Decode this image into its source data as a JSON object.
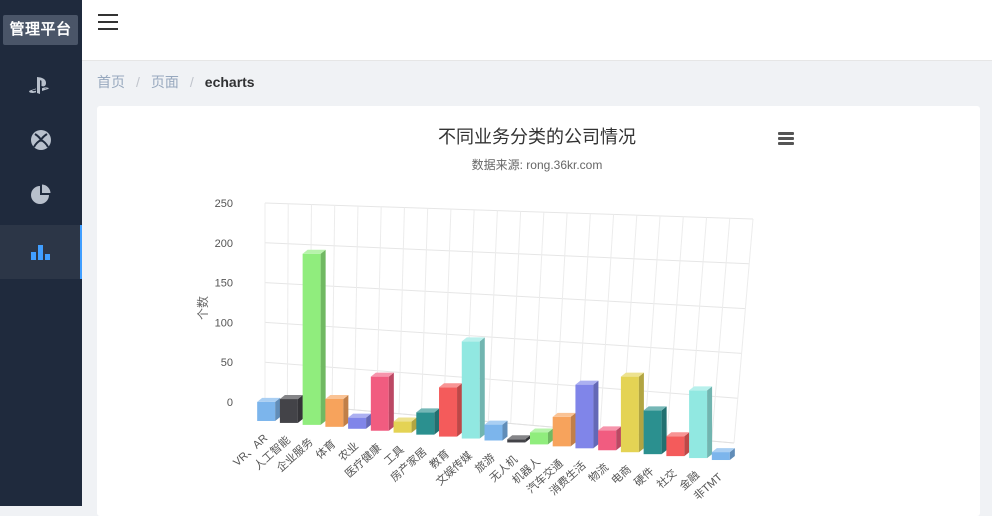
{
  "sidebar": {
    "brand": "管理平台",
    "items": [
      {
        "icon": "playstation-icon",
        "active": false
      },
      {
        "icon": "xbox-icon",
        "active": false
      },
      {
        "icon": "pie-chart-icon",
        "active": false
      },
      {
        "icon": "bar-chart-icon",
        "active": true
      }
    ],
    "active_color": "#409eff"
  },
  "header": {
    "menu_icon": "hamburger-menu-icon"
  },
  "breadcrumb": {
    "items": [
      "首页",
      "页面",
      "echarts"
    ]
  },
  "chart_data": {
    "type": "bar",
    "title": "不同业务分类的公司情况",
    "subtitle": "数据来源: rong.36kr.com",
    "ylabel": "个数",
    "xlabel": "",
    "ylim": [
      0,
      250
    ],
    "yticks": [
      0,
      50,
      100,
      150,
      200,
      250
    ],
    "grid": true,
    "categories": [
      "VR、AR",
      "人工智能",
      "企业服务",
      "体育",
      "农业",
      "医疗健康",
      "工具",
      "房产家居",
      "教育",
      "文娱传媒",
      "旅游",
      "无人机",
      "机器人",
      "汽车交通",
      "消费生活",
      "物流",
      "电商",
      "硬件",
      "社交",
      "金融",
      "非TMT"
    ],
    "values": [
      24,
      30,
      215,
      35,
      14,
      68,
      14,
      28,
      62,
      122,
      20,
      4,
      15,
      37,
      80,
      25,
      95,
      55,
      25,
      85,
      10
    ],
    "colors": [
      "#7cb5ec",
      "#434348",
      "#90ed7d",
      "#f7a35c",
      "#8085e9",
      "#f15c80",
      "#e4d354",
      "#2b908f",
      "#f45b5b",
      "#91e8e1",
      "#7cb5ec",
      "#434348",
      "#90ed7d",
      "#f7a35c",
      "#8085e9",
      "#f15c80",
      "#e4d354",
      "#2b908f",
      "#f45b5b",
      "#91e8e1",
      "#7cb5ec"
    ]
  }
}
